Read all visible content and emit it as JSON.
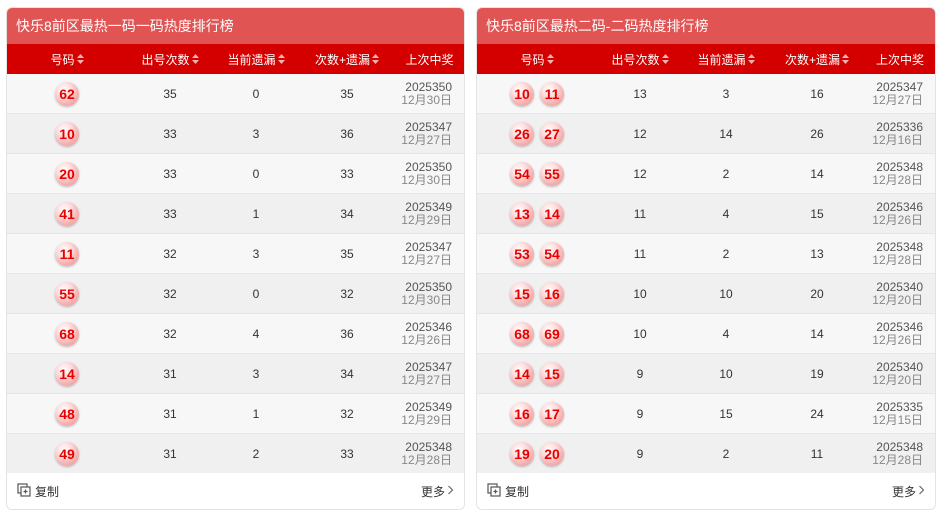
{
  "colors": {
    "title_bg": "#e05454",
    "header_bg": "#d40000",
    "ball_text": "#e60000"
  },
  "icons": [
    "sort-icon",
    "copy-icon",
    "chevron-right-icon"
  ],
  "left": {
    "title": "快乐8前区最热一码一码热度排行榜",
    "headers": [
      "号码",
      "出号次数",
      "当前遗漏",
      "次数+遗漏",
      "上次中奖"
    ],
    "rows": [
      {
        "nums": [
          "62"
        ],
        "count": "35",
        "current": "0",
        "sum": "35",
        "issue": "2025350",
        "date": "12月30日"
      },
      {
        "nums": [
          "10"
        ],
        "count": "33",
        "current": "3",
        "sum": "36",
        "issue": "2025347",
        "date": "12月27日"
      },
      {
        "nums": [
          "20"
        ],
        "count": "33",
        "current": "0",
        "sum": "33",
        "issue": "2025350",
        "date": "12月30日"
      },
      {
        "nums": [
          "41"
        ],
        "count": "33",
        "current": "1",
        "sum": "34",
        "issue": "2025349",
        "date": "12月29日"
      },
      {
        "nums": [
          "11"
        ],
        "count": "32",
        "current": "3",
        "sum": "35",
        "issue": "2025347",
        "date": "12月27日"
      },
      {
        "nums": [
          "55"
        ],
        "count": "32",
        "current": "0",
        "sum": "32",
        "issue": "2025350",
        "date": "12月30日"
      },
      {
        "nums": [
          "68"
        ],
        "count": "32",
        "current": "4",
        "sum": "36",
        "issue": "2025346",
        "date": "12月26日"
      },
      {
        "nums": [
          "14"
        ],
        "count": "31",
        "current": "3",
        "sum": "34",
        "issue": "2025347",
        "date": "12月27日"
      },
      {
        "nums": [
          "48"
        ],
        "count": "31",
        "current": "1",
        "sum": "32",
        "issue": "2025349",
        "date": "12月29日"
      },
      {
        "nums": [
          "49"
        ],
        "count": "31",
        "current": "2",
        "sum": "33",
        "issue": "2025348",
        "date": "12月28日"
      }
    ],
    "copy_label": "复制",
    "more_label": "更多"
  },
  "right": {
    "title": "快乐8前区最热二码-二码热度排行榜",
    "headers": [
      "号码",
      "出号次数",
      "当前遗漏",
      "次数+遗漏",
      "上次中奖"
    ],
    "rows": [
      {
        "nums": [
          "10",
          "11"
        ],
        "count": "13",
        "current": "3",
        "sum": "16",
        "issue": "2025347",
        "date": "12月27日"
      },
      {
        "nums": [
          "26",
          "27"
        ],
        "count": "12",
        "current": "14",
        "sum": "26",
        "issue": "2025336",
        "date": "12月16日"
      },
      {
        "nums": [
          "54",
          "55"
        ],
        "count": "12",
        "current": "2",
        "sum": "14",
        "issue": "2025348",
        "date": "12月28日"
      },
      {
        "nums": [
          "13",
          "14"
        ],
        "count": "11",
        "current": "4",
        "sum": "15",
        "issue": "2025346",
        "date": "12月26日"
      },
      {
        "nums": [
          "53",
          "54"
        ],
        "count": "11",
        "current": "2",
        "sum": "13",
        "issue": "2025348",
        "date": "12月28日"
      },
      {
        "nums": [
          "15",
          "16"
        ],
        "count": "10",
        "current": "10",
        "sum": "20",
        "issue": "2025340",
        "date": "12月20日"
      },
      {
        "nums": [
          "68",
          "69"
        ],
        "count": "10",
        "current": "4",
        "sum": "14",
        "issue": "2025346",
        "date": "12月26日"
      },
      {
        "nums": [
          "14",
          "15"
        ],
        "count": "9",
        "current": "10",
        "sum": "19",
        "issue": "2025340",
        "date": "12月20日"
      },
      {
        "nums": [
          "16",
          "17"
        ],
        "count": "9",
        "current": "15",
        "sum": "24",
        "issue": "2025335",
        "date": "12月15日"
      },
      {
        "nums": [
          "19",
          "20"
        ],
        "count": "9",
        "current": "2",
        "sum": "11",
        "issue": "2025348",
        "date": "12月28日"
      }
    ],
    "copy_label": "复制",
    "more_label": "更多"
  }
}
